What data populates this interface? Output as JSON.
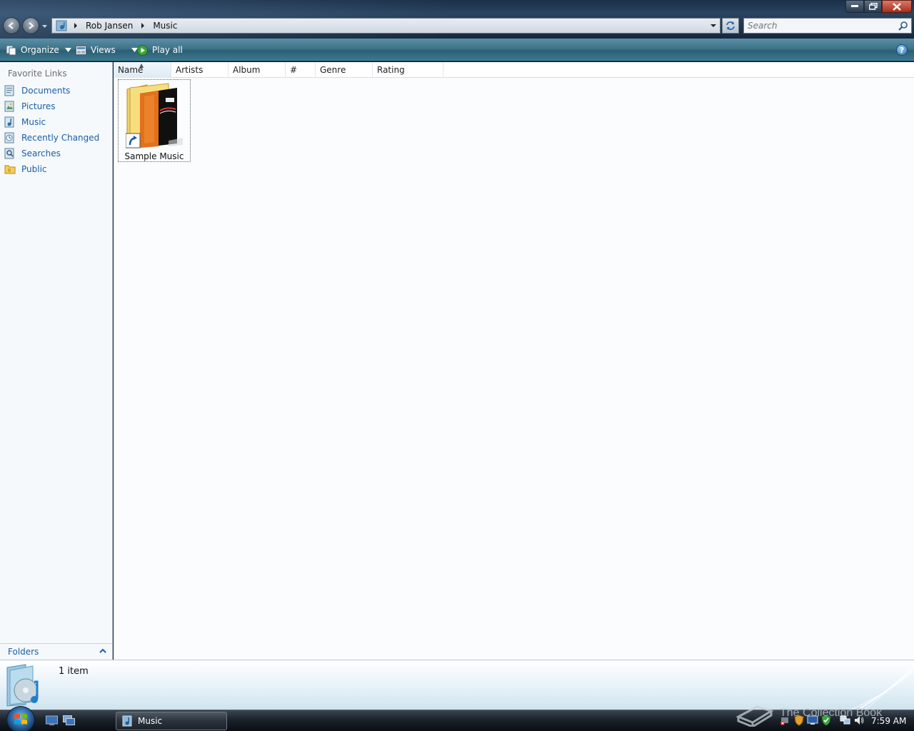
{
  "window": {
    "title": "Music"
  },
  "address": {
    "breadcrumbs": [
      "Rob Jansen",
      "Music"
    ],
    "icon": "music-folder-icon"
  },
  "search": {
    "placeholder": "Search"
  },
  "commandbar": {
    "organize": "Organize",
    "views": "Views",
    "play_all": "Play all",
    "help": "?"
  },
  "navpane": {
    "header": "Favorite Links",
    "items": [
      {
        "label": "Documents",
        "icon": "documents-icon"
      },
      {
        "label": "Pictures",
        "icon": "pictures-icon"
      },
      {
        "label": "Music",
        "icon": "music-icon"
      },
      {
        "label": "Recently Changed",
        "icon": "recently-changed-icon"
      },
      {
        "label": "Searches",
        "icon": "searches-icon"
      },
      {
        "label": "Public",
        "icon": "public-folder-icon"
      }
    ],
    "folders_label": "Folders"
  },
  "columns": [
    "Name",
    "Artists",
    "Album",
    "#",
    "Genre",
    "Rating"
  ],
  "items": [
    {
      "label": "Sample Music",
      "icon": "folder-shortcut-icon"
    }
  ],
  "details": {
    "count": "1 item"
  },
  "taskbar": {
    "task_label": "Music",
    "clock": "7:59 AM"
  },
  "watermark": "The Collection Book"
}
